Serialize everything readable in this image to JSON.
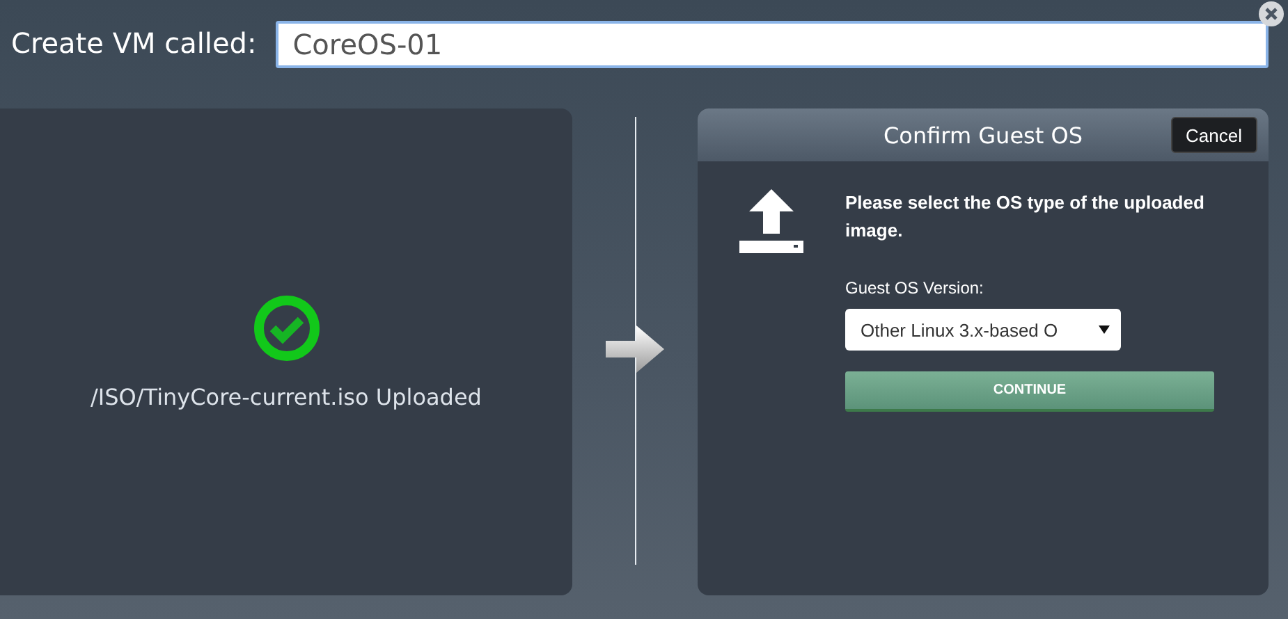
{
  "header": {
    "label": "Create VM called:",
    "vm_name": "CoreOS-01"
  },
  "upload_panel": {
    "status": "/ISO/TinyCore-current.iso Uploaded"
  },
  "dialog": {
    "title": "Confirm Guest OS",
    "cancel": "Cancel",
    "message": "Please select the OS type of the uploaded image.",
    "field_label": "Guest OS Version:",
    "os_version": "Other Linux 3.x-based O",
    "continue": "CONTINUE"
  }
}
